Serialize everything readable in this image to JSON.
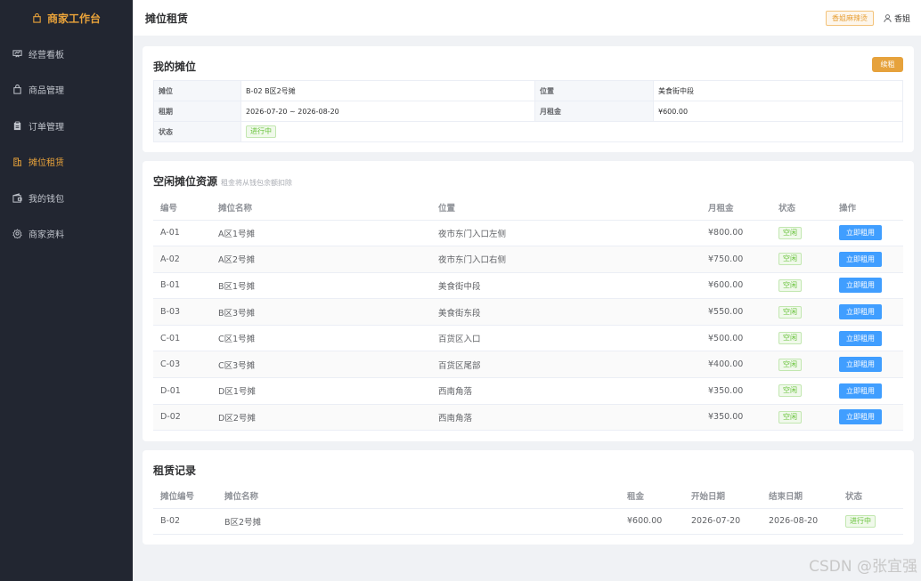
{
  "sidebar": {
    "brand": "商家工作台",
    "items": [
      {
        "label": "经营看板",
        "icon": "chart-board-icon"
      },
      {
        "label": "商品管理",
        "icon": "bag-icon"
      },
      {
        "label": "订单管理",
        "icon": "clipboard-icon"
      },
      {
        "label": "摊位租赁",
        "icon": "building-icon"
      },
      {
        "label": "我的钱包",
        "icon": "wallet-icon"
      },
      {
        "label": "商家资料",
        "icon": "gear-icon"
      }
    ],
    "active_index": 3
  },
  "header": {
    "title": "摊位租赁",
    "shop_tag": "香姐麻辣烫",
    "user": "香姐"
  },
  "my_stall": {
    "title": "我的摊位",
    "renew_label": "续租",
    "rows": [
      {
        "l1": "摊位",
        "v1": "B-02 B区2号摊",
        "l2": "位置",
        "v2": "美食街中段"
      },
      {
        "l1": "租期",
        "v1": "2026-07-20 ~ 2026-08-20",
        "l2": "月租金",
        "v2": "¥600.00"
      }
    ],
    "status_label": "状态",
    "status_value": "进行中"
  },
  "available": {
    "title": "空闲摊位资源",
    "subtitle": "租金将从钱包余额扣除",
    "headers": [
      "编号",
      "摊位名称",
      "位置",
      "月租金",
      "状态",
      "操作"
    ],
    "rows": [
      {
        "code": "A-01",
        "name": "A区1号摊",
        "loc": "夜市东门入口左侧",
        "rent": "¥800.00",
        "status": "空闲",
        "action": "立即租用"
      },
      {
        "code": "A-02",
        "name": "A区2号摊",
        "loc": "夜市东门入口右侧",
        "rent": "¥750.00",
        "status": "空闲",
        "action": "立即租用"
      },
      {
        "code": "B-01",
        "name": "B区1号摊",
        "loc": "美食街中段",
        "rent": "¥600.00",
        "status": "空闲",
        "action": "立即租用"
      },
      {
        "code": "B-03",
        "name": "B区3号摊",
        "loc": "美食街东段",
        "rent": "¥550.00",
        "status": "空闲",
        "action": "立即租用"
      },
      {
        "code": "C-01",
        "name": "C区1号摊",
        "loc": "百货区入口",
        "rent": "¥500.00",
        "status": "空闲",
        "action": "立即租用"
      },
      {
        "code": "C-03",
        "name": "C区3号摊",
        "loc": "百货区尾部",
        "rent": "¥400.00",
        "status": "空闲",
        "action": "立即租用"
      },
      {
        "code": "D-01",
        "name": "D区1号摊",
        "loc": "西南角落",
        "rent": "¥350.00",
        "status": "空闲",
        "action": "立即租用"
      },
      {
        "code": "D-02",
        "name": "D区2号摊",
        "loc": "西南角落",
        "rent": "¥350.00",
        "status": "空闲",
        "action": "立即租用"
      }
    ]
  },
  "records": {
    "title": "租赁记录",
    "headers": [
      "摊位编号",
      "摊位名称",
      "租金",
      "开始日期",
      "结束日期",
      "状态"
    ],
    "rows": [
      {
        "code": "B-02",
        "name": "B区2号摊",
        "rent": "¥600.00",
        "start": "2026-07-20",
        "end": "2026-08-20",
        "status": "进行中"
      }
    ]
  },
  "watermark": "CSDN @张宜强",
  "colors": {
    "sidebar_bg": "#222631",
    "accent_orange": "#e6a23c",
    "primary_blue": "#409eff",
    "success_green": "#67c23a"
  }
}
